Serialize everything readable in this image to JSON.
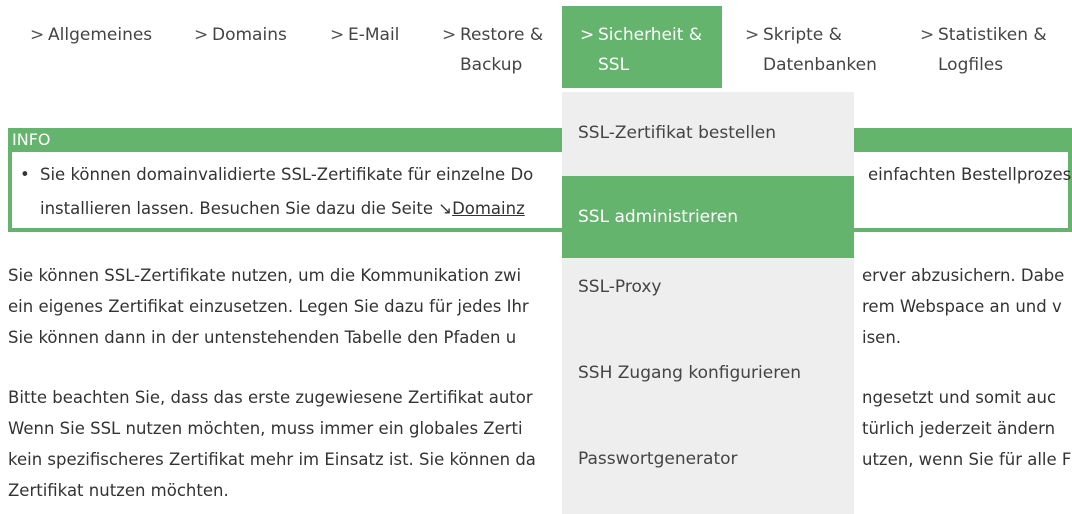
{
  "nav": {
    "items": [
      {
        "label1": "Allgemeines",
        "label2": ""
      },
      {
        "label1": "Domains",
        "label2": ""
      },
      {
        "label1": "E-Mail",
        "label2": ""
      },
      {
        "label1": "Restore &",
        "label2": "Backup"
      },
      {
        "label1": "Sicherheit &",
        "label2": "SSL"
      },
      {
        "label1": "Skripte &",
        "label2": "Datenbanken"
      },
      {
        "label1": "Statistiken &",
        "label2": "Logfiles"
      }
    ],
    "chevron": ">",
    "active_color": "#64b46d"
  },
  "dropdown": {
    "items": [
      "SSL-Zertifikat bestellen",
      "SSL administrieren",
      "SSL-Proxy",
      "SSH Zugang konfigurieren",
      "Passwortgenerator"
    ],
    "active_index": 1
  },
  "info": {
    "title": "INFO",
    "bullet": "•",
    "line1": "Sie können domainvalidierte SSL-Zertifikate für einzelne Do",
    "line1_end": "einfachten Bestellprozes",
    "line2": "installieren lassen. Besuchen Sie dazu die Seite ",
    "link_arrow": "↘",
    "link_text": "Domainz"
  },
  "paragraph1": {
    "l1a": "Sie können SSL-Zertifikate nutzen, um die Kommunikation zwi",
    "l1b": "erver abzusichern. Dabe",
    "l2a": "ein eigenes Zertifikat einzusetzen. Legen Sie dazu für jedes Ihr",
    "l2b": "rem Webspace an und v",
    "l3a": "Sie können dann in der untenstehenden Tabelle den Pfaden u",
    "l3b": "isen."
  },
  "paragraph2": {
    "l1a": "Bitte beachten Sie, dass das erste zugewiesene Zertifikat autor",
    "l1b": "ngesetzt und somit auc",
    "l2a": "Wenn Sie SSL nutzen möchten, muss immer ein globales Zerti",
    "l2b": "türlich jederzeit ändern",
    "l3a": "kein spezifischeres Zertifikat mehr im Einsatz ist. Sie können da",
    "l3b": "utzen, wenn Sie für alle F",
    "l4a": "Zertifikat nutzen möchten.",
    "l4b": ""
  }
}
